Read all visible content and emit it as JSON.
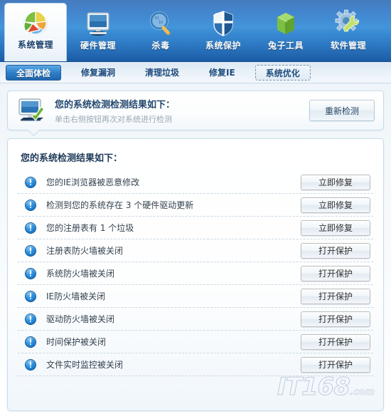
{
  "nav": {
    "items": [
      {
        "label": "系统管理",
        "icon": "pie-chart-icon",
        "active": true
      },
      {
        "label": "硬件管理",
        "icon": "monitor-icon",
        "active": false
      },
      {
        "label": "杀毒",
        "icon": "magnifier-icon",
        "active": false
      },
      {
        "label": "系统保护",
        "icon": "shield-icon",
        "active": false
      },
      {
        "label": "兔子工具",
        "icon": "green-box-icon",
        "active": false
      },
      {
        "label": "软件管理",
        "icon": "gear-wrench-icon",
        "active": false
      }
    ]
  },
  "tabs": [
    {
      "label": "全面体检",
      "state": "selected"
    },
    {
      "label": "修复漏洞",
      "state": "normal"
    },
    {
      "label": "清理垃圾",
      "state": "normal"
    },
    {
      "label": "修复IE",
      "state": "normal"
    },
    {
      "label": "系统优化",
      "state": "focused"
    }
  ],
  "info_panel": {
    "icon": "monitor-check-icon",
    "title": "您的系统检测检测结果如下：",
    "subtitle": "单击右侧按钮再次对系统进行检测",
    "rescan_button": "重新检测"
  },
  "results": {
    "title": "您的系统检测结果如下：",
    "rows": [
      {
        "icon": "info-exclamation-icon",
        "label": "您的IE浏览器被恶意修改",
        "action": "立即修复"
      },
      {
        "icon": "info-exclamation-icon",
        "label": "检测到您的系统存在 3 个硬件驱动更新",
        "action": "立即修复"
      },
      {
        "icon": "info-exclamation-icon",
        "label": "您的注册表有 1 个垃圾",
        "action": "立即修复"
      },
      {
        "icon": "info-exclamation-icon",
        "label": "注册表防火墙被关闭",
        "action": "打开保护"
      },
      {
        "icon": "info-exclamation-icon",
        "label": "系统防火墙被关闭",
        "action": "打开保护"
      },
      {
        "icon": "info-exclamation-icon",
        "label": "IE防火墙被关闭",
        "action": "打开保护"
      },
      {
        "icon": "info-exclamation-icon",
        "label": "驱动防火墙被关闭",
        "action": "打开保护"
      },
      {
        "icon": "info-exclamation-icon",
        "label": "时间保护被关闭",
        "action": "打开保护"
      },
      {
        "icon": "info-exclamation-icon",
        "label": "文件实时监控被关闭",
        "action": "打开保护"
      }
    ]
  },
  "watermark": {
    "text": "IT168",
    "suffix": ".com"
  },
  "colors": {
    "nav_blue_top": "#1d5fae",
    "nav_blue_mid": "#3f93da",
    "tab_selected": "#2f7fc9",
    "panel_border": "#c5dcec",
    "info_icon_blue": "#2b8ede",
    "title_text": "#24486f"
  }
}
